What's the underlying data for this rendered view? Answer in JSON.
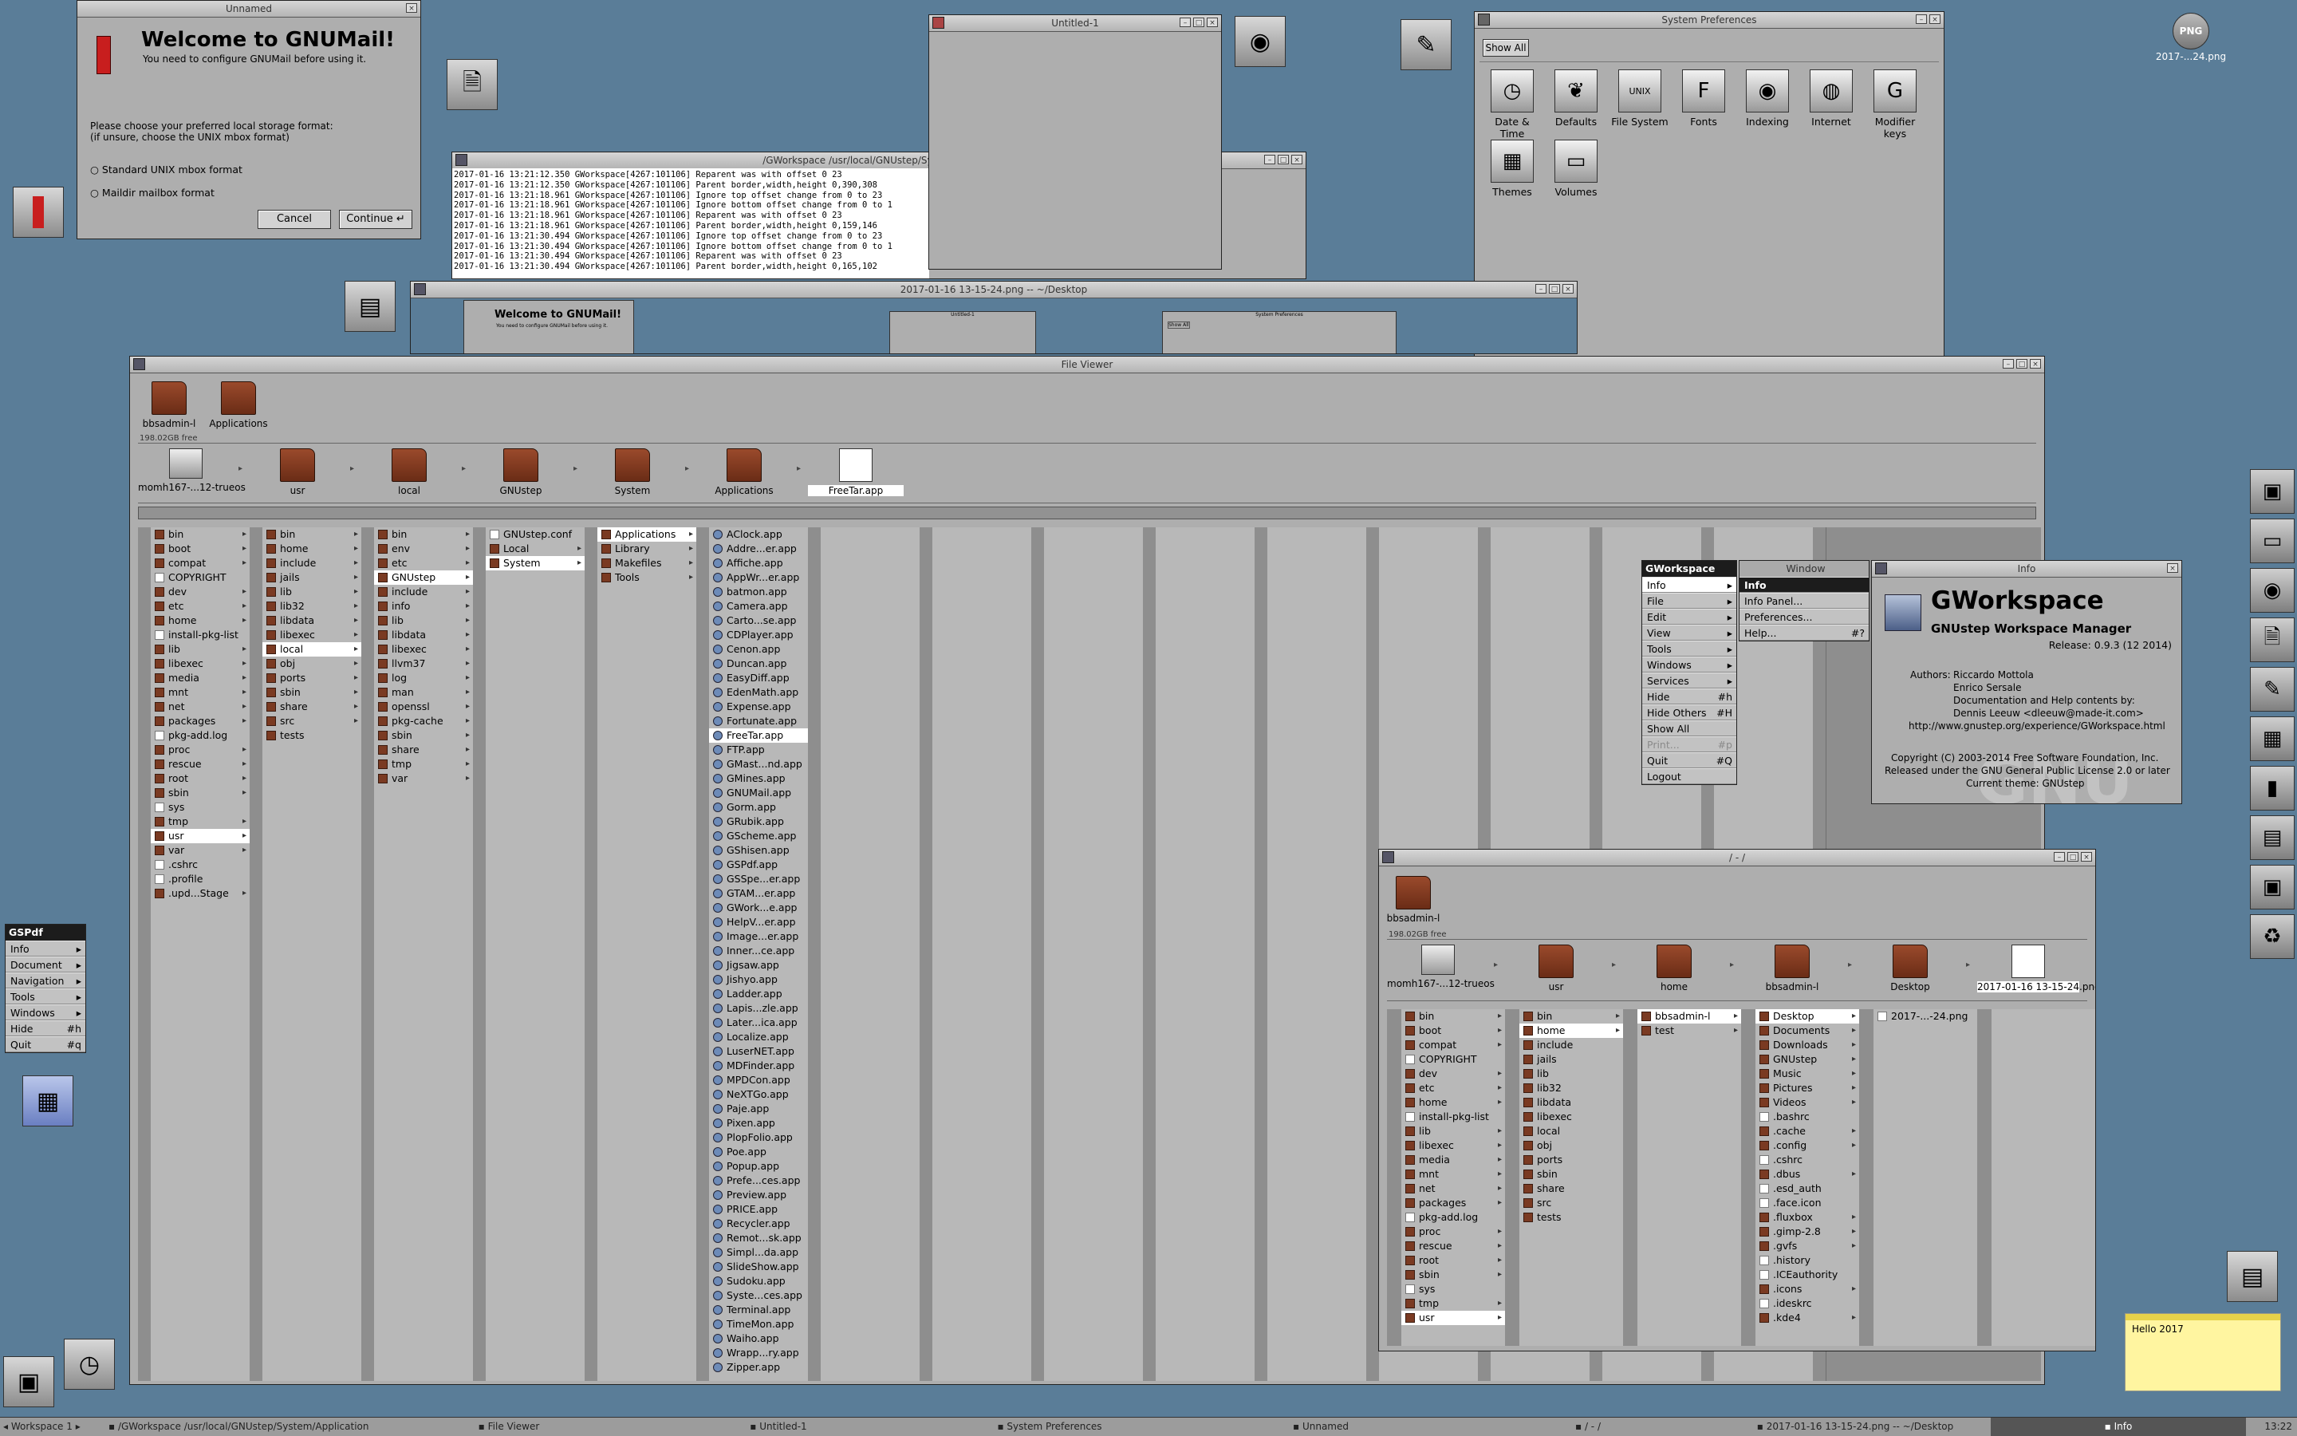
{
  "gnumail": {
    "title": "Unnamed",
    "heading": "Welcome to GNUMail!",
    "subheading": "You need to configure GNUMail before using it.",
    "prompt_line1": "Please choose your preferred local storage format:",
    "prompt_line2": "(if unsure, choose the UNIX mbox format)",
    "opt_mbox": "Standard UNIX mbox format",
    "opt_maildir": "Maildir mailbox format",
    "cancel": "Cancel",
    "continue": "Continue"
  },
  "console": {
    "title": "/GWorkspace /usr/local/GNUstep/System/Applica",
    "lines": [
      "2017-01-16 13:21:12.350 GWorkspace[4267:101106] Reparent was with offset 0 23",
      "2017-01-16 13:21:12.350 GWorkspace[4267:101106] Parent border,width,height 0,390,308",
      "2017-01-16 13:21:18.961 GWorkspace[4267:101106] Ignore top offset change from 0 to 23",
      "2017-01-16 13:21:18.961 GWorkspace[4267:101106] Ignore bottom offset change from 0 to 1",
      "2017-01-16 13:21:18.961 GWorkspace[4267:101106] Reparent was with offset 0 23",
      "2017-01-16 13:21:18.961 GWorkspace[4267:101106] Parent border,width,height 0,159,146",
      "2017-01-16 13:21:30.494 GWorkspace[4267:101106] Ignore top offset change from 0 to 23",
      "2017-01-16 13:21:30.494 GWorkspace[4267:101106] Ignore bottom offset change from 0 to 1",
      "2017-01-16 13:21:30.494 GWorkspace[4267:101106] Reparent was with offset 0 23",
      "2017-01-16 13:21:30.494 GWorkspace[4267:101106] Parent border,width,height 0,165,102"
    ]
  },
  "untitled": {
    "title": "Untitled-1"
  },
  "sysprefs": {
    "title": "System Preferences",
    "show_all": "Show All",
    "items": [
      "Date & Time",
      "Defaults",
      "File System",
      "Fonts",
      "Indexing",
      "Internet",
      "Modifier keys",
      "Themes",
      "Volumes"
    ],
    "icons": [
      "clock-icon",
      "defaults-icon",
      "unix-icon",
      "fonts-icon",
      "indexing-icon",
      "globe-icon",
      "key-icon",
      "themes-icon",
      "volume-icon"
    ],
    "glyphs": [
      "◷",
      "❦",
      "UNIX",
      "F",
      "◉",
      "◍",
      "G",
      "▦",
      "▭"
    ]
  },
  "screenshot_win": {
    "title": "2017-01-16 13-15-24.png  --  ~/Desktop",
    "mini_heading": "Welcome to GNUMail!",
    "mini_sub": "You need to configure GNUMail before using it.",
    "mini_untitled": "Untitled-1",
    "mini_sysprefs": "System Preferences",
    "mini_showall": "Show All"
  },
  "fileviewer": {
    "title": "File Viewer",
    "shelf": [
      "bbsadmin-l",
      "Applications"
    ],
    "free": "198.02GB free",
    "path": [
      "momh167-...12-trueos",
      "usr",
      "local",
      "GNUstep",
      "System",
      "Applications",
      "FreeTar.app"
    ],
    "columns": [
      {
        "items": [
          "bin",
          "boot",
          "compat",
          "COPYRIGHT",
          "dev",
          "etc",
          "home",
          "install-pkg-list",
          "lib",
          "libexec",
          "media",
          "mnt",
          "net",
          "packages",
          "pkg-add.log",
          "proc",
          "rescue",
          "root",
          "sbin",
          "sys",
          "tmp",
          "usr",
          "var",
          ".cshrc",
          ".profile",
          ".upd...Stage"
        ],
        "sel": 21,
        "files": [
          3,
          7,
          14,
          19,
          23,
          24
        ],
        "arrows": [
          0,
          1,
          2,
          4,
          5,
          6,
          8,
          9,
          10,
          11,
          12,
          13,
          15,
          16,
          17,
          18,
          20,
          21,
          22,
          25
        ]
      },
      {
        "items": [
          "bin",
          "home",
          "include",
          "jails",
          "lib",
          "lib32",
          "libdata",
          "libexec",
          "local",
          "obj",
          "ports",
          "sbin",
          "share",
          "src",
          "tests"
        ],
        "sel": 8,
        "files": [],
        "arrows": [
          0,
          1,
          2,
          3,
          4,
          5,
          6,
          7,
          8,
          9,
          10,
          11,
          12,
          13
        ]
      },
      {
        "items": [
          "bin",
          "env",
          "etc",
          "GNUstep",
          "include",
          "info",
          "lib",
          "libdata",
          "libexec",
          "llvm37",
          "log",
          "man",
          "openssl",
          "pkg-cache",
          "sbin",
          "share",
          "tmp",
          "var"
        ],
        "sel": 3,
        "files": [],
        "arrows": [
          0,
          1,
          2,
          3,
          4,
          5,
          6,
          7,
          8,
          9,
          10,
          11,
          12,
          13,
          14,
          15,
          16,
          17
        ]
      },
      {
        "items": [
          "GNUstep.conf",
          "Local",
          "System"
        ],
        "sel": 2,
        "files": [
          0
        ],
        "arrows": [
          1,
          2
        ]
      },
      {
        "items": [
          "Applications",
          "Library",
          "Makefiles",
          "Tools"
        ],
        "sel": 0,
        "files": [],
        "arrows": [
          0,
          1,
          2,
          3
        ]
      },
      {
        "items": [
          "AClock.app",
          "Addre...er.app",
          "Affiche.app",
          "AppWr...er.app",
          "batmon.app",
          "Camera.app",
          "Carto...se.app",
          "CDPlayer.app",
          "Cenon.app",
          "Duncan.app",
          "EasyDiff.app",
          "EdenMath.app",
          "Expense.app",
          "Fortunate.app",
          "FreeTar.app",
          "FTP.app",
          "GMast...nd.app",
          "GMines.app",
          "GNUMail.app",
          "Gorm.app",
          "GRubik.app",
          "GScheme.app",
          "GShisen.app",
          "GSPdf.app",
          "GSSpe...er.app",
          "GTAM...er.app",
          "GWork...e.app",
          "HelpV...er.app",
          "Image...er.app",
          "Inner...ce.app",
          "Jigsaw.app",
          "Jishyo.app",
          "Ladder.app",
          "Lapis...zle.app",
          "Later...ica.app",
          "Localize.app",
          "LuserNET.app",
          "MDFinder.app",
          "MPDCon.app",
          "NeXTGo.app",
          "Paje.app",
          "Pixen.app",
          "PlopFolio.app",
          "Poe.app",
          "Popup.app",
          "Prefe...ces.app",
          "Preview.app",
          "PRICE.app",
          "Recycler.app",
          "Remot...sk.app",
          "Simpl...da.app",
          "SlideShow.app",
          "Sudoku.app",
          "Syste...ces.app",
          "Terminal.app",
          "TimeMon.app",
          "Waiho.app",
          "Wrapp...ry.app",
          "Zipper.app"
        ],
        "sel": 14,
        "files": [],
        "arrows": [],
        "app": true
      }
    ]
  },
  "gws_menu": {
    "title": "GWorkspace",
    "items": [
      {
        "label": "Info",
        "key": "▸"
      },
      {
        "label": "File",
        "key": "▸"
      },
      {
        "label": "Edit",
        "key": "▸"
      },
      {
        "label": "View",
        "key": "▸"
      },
      {
        "label": "Tools",
        "key": "▸"
      },
      {
        "label": "Windows",
        "key": "▸"
      },
      {
        "label": "Services",
        "key": "▸"
      },
      {
        "label": "Hide",
        "key": "#h"
      },
      {
        "label": "Hide Others",
        "key": "#H"
      },
      {
        "label": "Show All",
        "key": ""
      },
      {
        "label": "Print...",
        "key": "#p"
      },
      {
        "label": "Quit",
        "key": "#Q"
      },
      {
        "label": "Logout",
        "key": ""
      }
    ]
  },
  "info_submenu": {
    "title_window": "Window",
    "items": [
      {
        "label": "Info",
        "key": ""
      },
      {
        "label": "Info Panel...",
        "key": ""
      },
      {
        "label": "Preferences...",
        "key": ""
      },
      {
        "label": "Help...",
        "key": "#?"
      }
    ]
  },
  "info_panel": {
    "title": "Info",
    "app_name": "GWorkspace",
    "subtitle": "GNUstep Workspace Manager",
    "release": "Release: 0.9.3 (12 2014)",
    "authors_label": "Authors:",
    "author1": "Riccardo Mottola",
    "author2": "Enrico Sersale",
    "doc_line": "Documentation and Help contents by:",
    "doc_author": "Dennis Leeuw <dleeuw@made-it.com>",
    "url": "http://www.gnustep.org/experience/GWorkspace.html",
    "copyright": "Copyright (C) 2003-2014 Free Software Foundation, Inc.",
    "license": "Released under the GNU General Public License 2.0 or later",
    "theme": "Current theme: GNUstep",
    "watermark": "GNU"
  },
  "viewer2": {
    "title": "/ - /",
    "shelf": [
      "bbsadmin-l"
    ],
    "free": "198.02GB free",
    "path": [
      "momh167-...12-trueos",
      "usr",
      "home",
      "bbsadmin-l",
      "Desktop",
      "2017-01-16 13-15-24.png"
    ],
    "columns": [
      {
        "items": [
          "bin",
          "boot",
          "compat",
          "COPYRIGHT",
          "dev",
          "etc",
          "home",
          "install-pkg-list",
          "lib",
          "libexec",
          "media",
          "mnt",
          "net",
          "packages",
          "pkg-add.log",
          "proc",
          "rescue",
          "root",
          "sbin",
          "sys",
          "tmp",
          "usr"
        ],
        "sel": 21,
        "files": [
          3,
          7,
          14,
          19
        ],
        "arrows": [
          0,
          1,
          2,
          4,
          5,
          6,
          8,
          9,
          10,
          11,
          12,
          13,
          15,
          16,
          17,
          18,
          20,
          21
        ]
      },
      {
        "items": [
          "bin",
          "home",
          "include",
          "jails",
          "lib",
          "lib32",
          "libdata",
          "libexec",
          "local",
          "obj",
          "ports",
          "sbin",
          "share",
          "src",
          "tests"
        ],
        "sel": 1,
        "files": [],
        "arrows": [
          0,
          1
        ]
      },
      {
        "items": [
          "bbsadmin-l",
          "test"
        ],
        "sel": 0,
        "files": [],
        "arrows": [
          0,
          1
        ]
      },
      {
        "items": [
          "Desktop",
          "Documents",
          "Downloads",
          "GNUstep",
          "Music",
          "Pictures",
          "Videos",
          ".bashrc",
          ".cache",
          ".config",
          ".cshrc",
          ".dbus",
          ".esd_auth",
          ".face.icon",
          ".fluxbox",
          ".gimp-2.8",
          ".gvfs",
          ".history",
          ".ICEauthority",
          ".icons",
          ".ideskrc",
          ".kde4"
        ],
        "sel": 0,
        "files": [
          7,
          10,
          12,
          13,
          17,
          18,
          20
        ],
        "arrows": [
          0,
          1,
          2,
          3,
          4,
          5,
          6,
          8,
          9,
          11,
          14,
          15,
          16,
          19,
          21
        ]
      },
      {
        "items": [
          "2017-...-24.png"
        ],
        "sel": -1,
        "files": [
          0
        ],
        "arrows": []
      }
    ]
  },
  "gspdf_menu": {
    "title": "GSPdf",
    "items": [
      {
        "label": "Info",
        "key": "▸"
      },
      {
        "label": "Document",
        "key": "▸"
      },
      {
        "label": "Navigation",
        "key": "▸"
      },
      {
        "label": "Tools",
        "key": "▸"
      },
      {
        "label": "Windows",
        "key": "▸"
      },
      {
        "label": "Hide",
        "key": "#h"
      },
      {
        "label": "Quit",
        "key": "#q"
      }
    ]
  },
  "desktop": {
    "png_label": "2017-...24.png",
    "png_badge": "PNG",
    "note": "Hello 2017"
  },
  "taskbar": {
    "workspace": "Workspace 1",
    "tasks": [
      "/GWorkspace /usr/local/GNUstep/System/Application",
      "File Viewer",
      "Untitled-1",
      "System Preferences",
      "Unnamed",
      "/ - /",
      "2017-01-16 13-15-24.png  --  ~/Desktop",
      "Info"
    ],
    "clock": "13:22"
  },
  "colors": {
    "desktop": "#5a7d98",
    "panel": "#aeaeae",
    "selection": "#ffffff",
    "folder": "#7a3a22"
  }
}
